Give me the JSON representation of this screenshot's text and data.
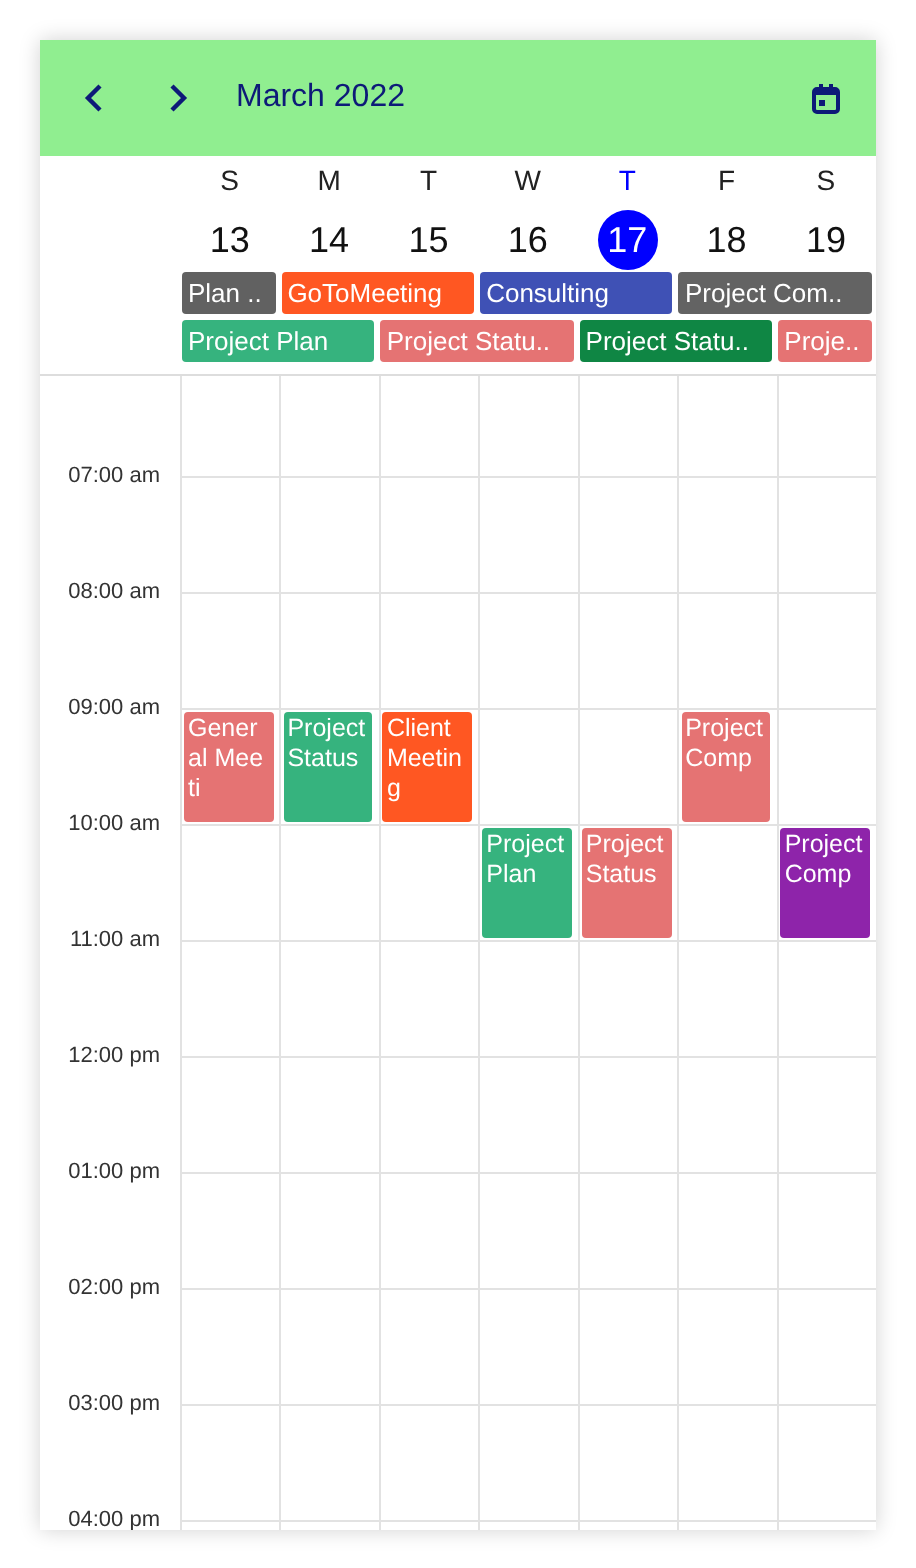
{
  "header": {
    "title": "March 2022"
  },
  "days": [
    {
      "letter": "S",
      "date": "13",
      "selected": false
    },
    {
      "letter": "M",
      "date": "14",
      "selected": false
    },
    {
      "letter": "T",
      "date": "15",
      "selected": false
    },
    {
      "letter": "W",
      "date": "16",
      "selected": false
    },
    {
      "letter": "T",
      "date": "17",
      "selected": true
    },
    {
      "letter": "F",
      "date": "18",
      "selected": false
    },
    {
      "letter": "S",
      "date": "19",
      "selected": false
    }
  ],
  "all_day_rows": [
    [
      {
        "subject": "Plan ..",
        "kind": "single",
        "color": "#616161"
      },
      {
        "subject": "GoToMeeting",
        "kind": "double",
        "color": "#ff5722"
      },
      {
        "subject": "Consulting",
        "kind": "double",
        "color": "#3f51b5"
      },
      {
        "subject": "Project Com..",
        "kind": "double",
        "color": "#636363"
      }
    ],
    [
      {
        "subject": "Project Plan",
        "kind": "double",
        "color": "#36b37e"
      },
      {
        "subject": "Project Statu..",
        "kind": "double",
        "color": "#e57373"
      },
      {
        "subject": "Project Statu..",
        "kind": "double",
        "color": "#0f8644"
      },
      {
        "subject": "Proje..",
        "kind": "single",
        "color": "#e57373"
      }
    ]
  ],
  "hours": [
    {
      "label": "07:00 am",
      "cells": [
        null,
        null,
        null,
        null,
        null,
        null,
        null
      ]
    },
    {
      "label": "08:00 am",
      "cells": [
        null,
        null,
        null,
        null,
        null,
        null,
        null
      ]
    },
    {
      "label": "09:00 am",
      "cells": [
        {
          "subject": "General Meeti",
          "color": "#e57373"
        },
        {
          "subject": "Project Status",
          "color": "#36b37e"
        },
        {
          "subject": "Client Meeting",
          "color": "#ff5722"
        },
        null,
        null,
        {
          "subject": "Project Comp",
          "color": "#e57373"
        },
        null
      ]
    },
    {
      "label": "10:00 am",
      "cells": [
        null,
        null,
        null,
        {
          "subject": "Project Plan",
          "color": "#36b37e"
        },
        {
          "subject": "Project Status",
          "color": "#e57373"
        },
        null,
        {
          "subject": "Project Comp",
          "color": "#8e24aa"
        }
      ]
    },
    {
      "label": "11:00 am",
      "cells": [
        null,
        null,
        null,
        null,
        null,
        null,
        null
      ]
    },
    {
      "label": "12:00 pm",
      "cells": [
        null,
        null,
        null,
        null,
        null,
        null,
        null
      ]
    },
    {
      "label": "01:00 pm",
      "cells": [
        null,
        null,
        null,
        null,
        null,
        null,
        null
      ]
    },
    {
      "label": "02:00 pm",
      "cells": [
        null,
        null,
        null,
        null,
        null,
        null,
        null
      ]
    },
    {
      "label": "03:00 pm",
      "cells": [
        null,
        null,
        null,
        null,
        null,
        null,
        null
      ]
    },
    {
      "label": "04:00 pm",
      "cells": [
        null,
        null,
        null,
        null,
        null,
        null,
        null
      ]
    }
  ]
}
